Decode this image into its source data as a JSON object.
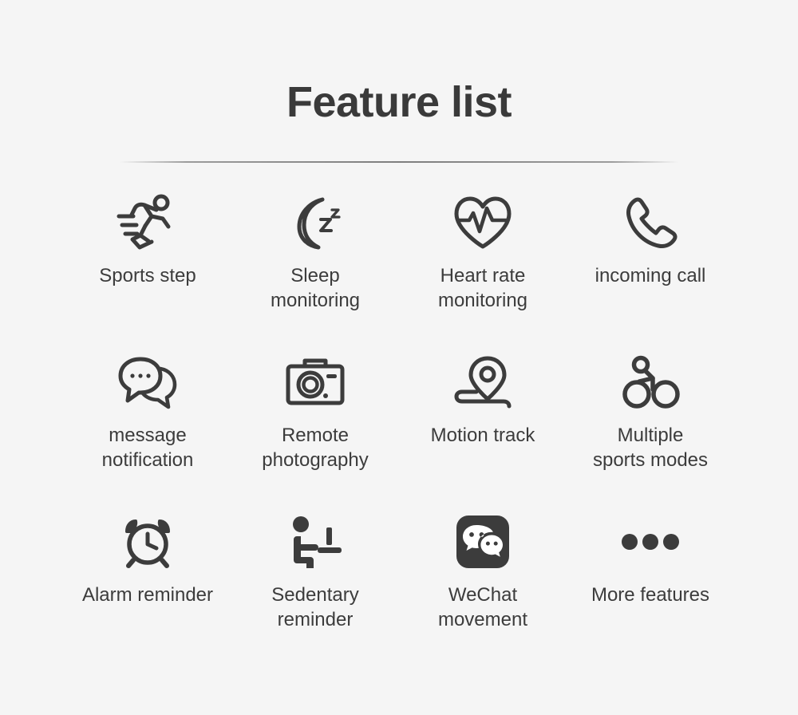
{
  "header": {
    "title": "Feature list"
  },
  "theme": {
    "background": "#f5f5f5",
    "text_color": "#3c3c3c",
    "title_color": "#3a3a3a",
    "icon_color": "#3c3c3c",
    "divider_color": "#888888"
  },
  "features": [
    {
      "icon": "running-person-icon",
      "label": "Sports step"
    },
    {
      "icon": "moon-sleep-icon",
      "label": "Sleep\nmonitoring"
    },
    {
      "icon": "heart-pulse-icon",
      "label": "Heart rate\nmonitoring"
    },
    {
      "icon": "phone-handset-icon",
      "label": "incoming call"
    },
    {
      "icon": "chat-bubbles-icon",
      "label": "message\nnotification"
    },
    {
      "icon": "camera-icon",
      "label": "Remote\nphotography"
    },
    {
      "icon": "map-pin-track-icon",
      "label": "Motion track"
    },
    {
      "icon": "bicycle-icon",
      "label": "Multiple\nsports modes"
    },
    {
      "icon": "alarm-clock-icon",
      "label": "Alarm reminder"
    },
    {
      "icon": "sedentary-desk-icon",
      "label": "Sedentary\nreminder"
    },
    {
      "icon": "wechat-logo-icon",
      "label": "WeChat\nmovement"
    },
    {
      "icon": "more-dots-icon",
      "label": "More features"
    }
  ]
}
